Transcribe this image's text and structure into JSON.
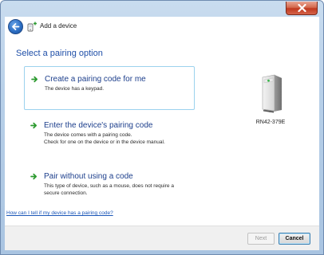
{
  "window": {
    "title": "Add a device",
    "accent_color": "#1f4fa8",
    "close_icon": "close-icon",
    "back_icon": "back-arrow-icon"
  },
  "main": {
    "heading": "Select a pairing option",
    "options": [
      {
        "title": "Create a pairing code for me",
        "description_lines": [
          "The device has a keypad."
        ],
        "selected": true
      },
      {
        "title": "Enter the device's pairing code",
        "description_lines": [
          "The device comes with a pairing code.",
          "Check for one on the device or in the device manual."
        ],
        "selected": false
      },
      {
        "title": "Pair without using a code",
        "description_lines": [
          "This type of device, such as a mouse, does not require a",
          "secure connection."
        ],
        "selected": false
      }
    ],
    "help_link": "How can I tell if my device has a pairing code?",
    "device": {
      "name": "RN42-379E",
      "icon": "pc-tower-icon"
    }
  },
  "footer": {
    "next_label": "Next",
    "cancel_label": "Cancel"
  }
}
